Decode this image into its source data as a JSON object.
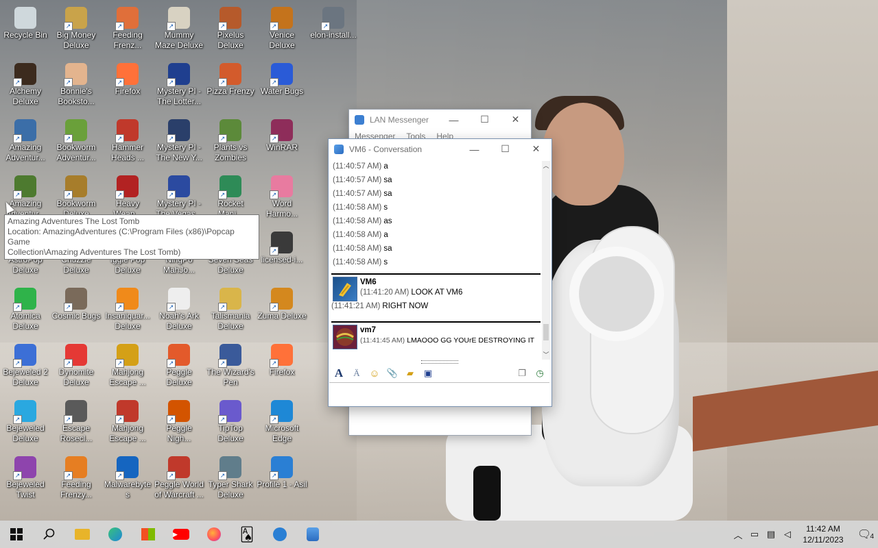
{
  "desktop_icons": [
    {
      "label": "Recycle Bin",
      "color": "#cfd8dc"
    },
    {
      "label": "Big Money Deluxe",
      "color": "#c9a34a"
    },
    {
      "label": "Feeding Frenz...",
      "color": "#e06f3a"
    },
    {
      "label": "Mummy Maze Deluxe",
      "color": "#d8d2c2"
    },
    {
      "label": "Pixelus Deluxe",
      "color": "#b65a2b"
    },
    {
      "label": "Venice Deluxe",
      "color": "#c4731c"
    },
    {
      "label": "elon-install...",
      "color": "#6b7580"
    },
    {
      "label": "Alchemy Deluxe",
      "color": "#3c2b1e"
    },
    {
      "label": "Bonnie's Booksto...",
      "color": "#e3b48e"
    },
    {
      "label": "Firefox",
      "color": "#ff7139"
    },
    {
      "label": "Mystery PI - The Lotter...",
      "color": "#1f3f8f"
    },
    {
      "label": "Pizza Frenzy",
      "color": "#d35b2c"
    },
    {
      "label": "Water Bugs",
      "color": "#2a5bd7"
    },
    {
      "label": "Amazing Adventur...",
      "color": "#3b6ea8"
    },
    {
      "label": "Bookworm Adventur...",
      "color": "#6aa03a"
    },
    {
      "label": "Hammer Heads ...",
      "color": "#c0392b"
    },
    {
      "label": "Mystery PI - The New Y...",
      "color": "#2a3f6a"
    },
    {
      "label": "Plants vs Zombies",
      "color": "#5c8a3a"
    },
    {
      "label": "WinRAR",
      "color": "#8e2d5a"
    },
    {
      "label": "Amazing Adventur...",
      "color": "#4d7a2f"
    },
    {
      "label": "Bookworm Deluxe",
      "color": "#a77d2b"
    },
    {
      "label": "Heavy Weap...",
      "color": "#b22222"
    },
    {
      "label": "Mystery PI - The Vegas...",
      "color": "#2b4aa0"
    },
    {
      "label": "Rocket Mani...",
      "color": "#2e8b57"
    },
    {
      "label": "Word Harmo...",
      "color": "#e87ba0"
    },
    {
      "label": "AstroPop Deluxe",
      "color": "#4a5bd0"
    },
    {
      "label": "Chuzzle Deluxe",
      "color": "#e2952a"
    },
    {
      "label": "Iggle Pop Deluxe",
      "color": "#7fbf3a"
    },
    {
      "label": "NingPo MahJo...",
      "color": "#b3342a"
    },
    {
      "label": "Seven Seas Deluxe",
      "color": "#2f7fb0"
    },
    {
      "label": "licensed-i...",
      "color": "#3a3a3a"
    },
    {
      "label": "Atomica Deluxe",
      "color": "#2fb34a"
    },
    {
      "label": "Cosmic Bugs",
      "color": "#7a6a5a"
    },
    {
      "label": "Insaniquar... Deluxe",
      "color": "#f08a1a"
    },
    {
      "label": "Noah's Ark Deluxe",
      "color": "#eeeeee"
    },
    {
      "label": "Talismania Deluxe",
      "color": "#d9b54a"
    },
    {
      "label": "Zuma Deluxe",
      "color": "#d4881e"
    },
    {
      "label": "Bejeweled 2 Deluxe",
      "color": "#3c6fd6"
    },
    {
      "label": "Dynomite Deluxe",
      "color": "#e53935"
    },
    {
      "label": "Mahjong Escape ...",
      "color": "#d4a017"
    },
    {
      "label": "Peggle Deluxe",
      "color": "#e35a2b"
    },
    {
      "label": "The Wizard's Pen",
      "color": "#3a5a9a"
    },
    {
      "label": "Firefox",
      "color": "#ff7139"
    },
    {
      "label": "Bejeweled Deluxe",
      "color": "#2aa8e0"
    },
    {
      "label": "Escape Rosecl...",
      "color": "#5a5a5a"
    },
    {
      "label": "Mahjong Escape ...",
      "color": "#c0392b"
    },
    {
      "label": "Peggle Nigh...",
      "color": "#d35400"
    },
    {
      "label": "TipTop Deluxe",
      "color": "#6a5acd"
    },
    {
      "label": "Microsoft Edge",
      "color": "#1e88d6"
    },
    {
      "label": "Bejeweled Twist",
      "color": "#8e44ad"
    },
    {
      "label": "Feeding Frenzy...",
      "color": "#e67e22"
    },
    {
      "label": "Malwarebyte s",
      "color": "#1565c0"
    },
    {
      "label": "Peggle World of Warcraft ...",
      "color": "#c0392b"
    },
    {
      "label": "Typer Shark Deluxe",
      "color": "#607d8b"
    },
    {
      "label": "Profile 1 - Asil",
      "color": "#2a7fd4"
    }
  ],
  "tooltip": {
    "line1": "Amazing Adventures The Lost Tomb",
    "line2": "Location: AmazingAdventures (C:\\Program Files (x86)\\Popcap Game",
    "line3": "Collection\\Amazing Adventures The Lost Tomb)"
  },
  "lan_window": {
    "title": "LAN Messenger",
    "menu": [
      "Messenger",
      "Tools",
      "Help"
    ]
  },
  "conversation": {
    "title": "VM6 - Conversation",
    "lines": [
      {
        "time": "(11:40:57 AM)",
        "text": "a"
      },
      {
        "time": "(11:40:57 AM)",
        "text": "sa"
      },
      {
        "time": "(11:40:57 AM)",
        "text": "sa"
      },
      {
        "time": "(11:40:58 AM)",
        "text": "s"
      },
      {
        "time": "(11:40:58 AM)",
        "text": "as"
      },
      {
        "time": "(11:40:58 AM)",
        "text": "a"
      },
      {
        "time": "(11:40:58 AM)",
        "text": "sa"
      },
      {
        "time": "(11:40:58 AM)",
        "text": "s"
      }
    ],
    "block1": {
      "sender": "VM6",
      "m1_time": "(11:41:20 AM)",
      "m1_text": "LOOK AT VM6",
      "m2_time": "(11:41:21 AM)",
      "m2_text": "RIGHT NOW"
    },
    "block2": {
      "sender": "vm7",
      "m1_time": "(11:41:45 AM)",
      "m1_text": "LMAOOO GG YOUrE DESTROYING IT"
    }
  },
  "taskbar": {
    "time": "11:42 AM",
    "date": "12/11/2023",
    "notifications": "4"
  }
}
